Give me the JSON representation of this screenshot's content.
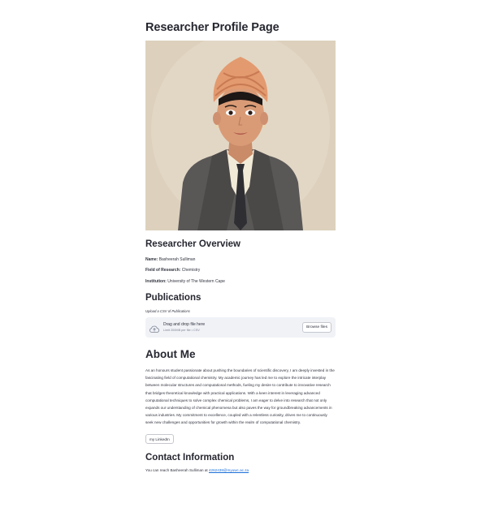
{
  "page": {
    "title": "Researcher Profile Page"
  },
  "overview": {
    "heading": "Researcher Overview",
    "name_label": "Name:",
    "name_value": "Basheerah Sulliman",
    "field_label": "Field of Research:",
    "field_value": "Chemistry",
    "institution_label": "Institution:",
    "institution_value": "University of The Western Cape"
  },
  "publications": {
    "heading": "Publications",
    "upload_label": "Upload a CSV of Publications",
    "drop_title": "Drag and drop file here",
    "drop_limit": "Limit 200MB per file • CSV",
    "browse_label": "Browse files",
    "upload_icon": "cloud-upload-icon"
  },
  "about": {
    "heading": "About Me",
    "text": "As an honours student passionate about pushing the boundaries of scientific discovery, I am deeply invested in the fascinating field of computational chemistry. My academic journey has led me to explore the intricate interplay between molecular structures and computational methods, fueling my desire to contribute to innovative research that bridges theoretical knowledge with practical applications. With a keen interest in leveraging advanced computational techniques to solve complex chemical problems, I am eager to delve into research that not only expands our understanding of chemical phenomena but also paves the way for groundbreaking advancements in various industries. My commitment to excellence, coupled with a relentless curiosity, drives me to continuously seek new challenges and opportunities for growth within the realm of computational chemistry.",
    "linkedin_label": "my LinkedIn"
  },
  "contact": {
    "heading": "Contact Information",
    "prefix": "You can reach Basheerah Sulliman at",
    "email": "4262438@myuwc.ac.za"
  },
  "colors": {
    "background": "#ffffff",
    "text": "#31333f",
    "dropzone": "#f0f2f6",
    "link": "#1c6fd9",
    "turban": "#e39a6f",
    "portrait_bg": "#ddd1bd"
  }
}
